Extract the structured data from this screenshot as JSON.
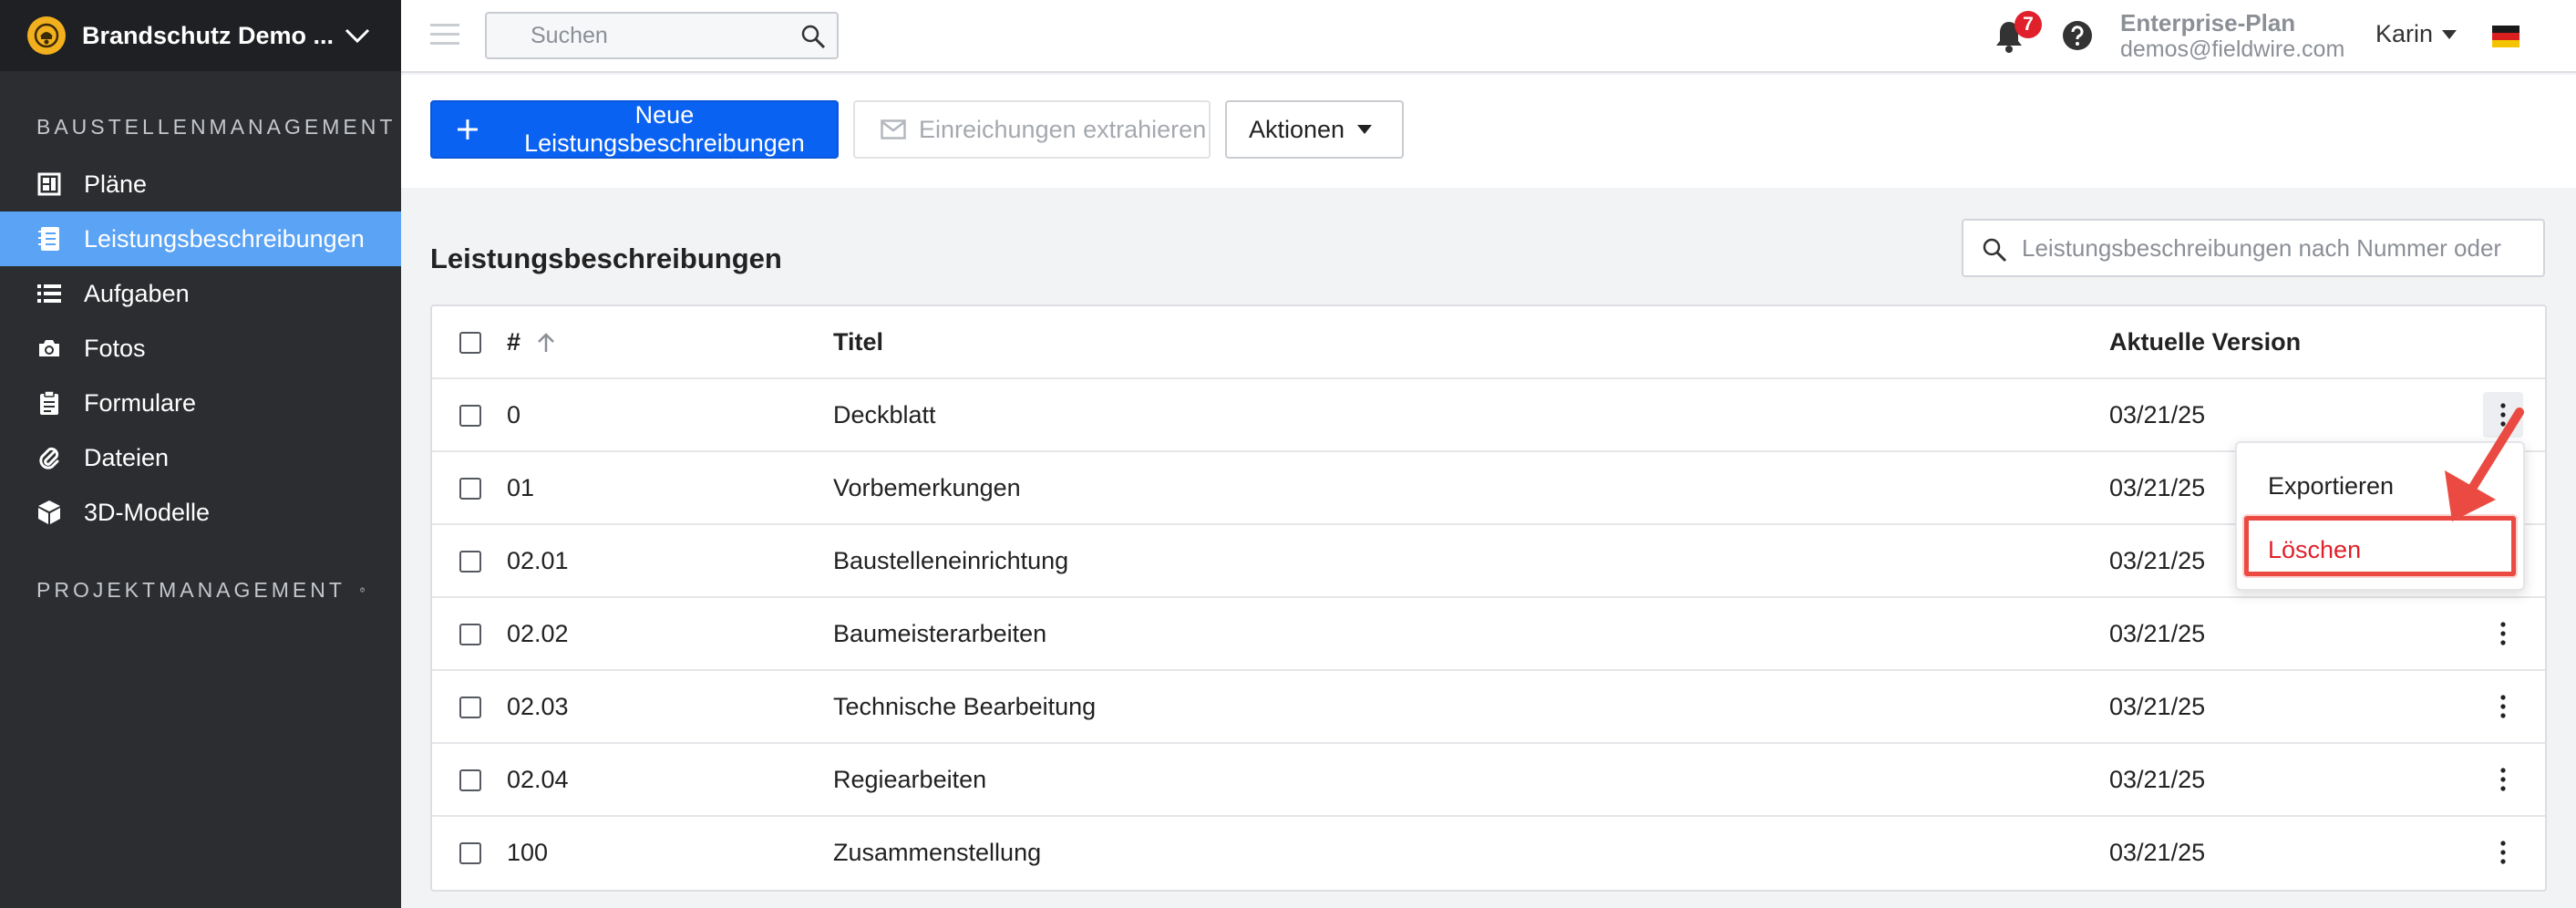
{
  "sidebar": {
    "project_name": "Brandschutz Demo ...",
    "section_site": "BAUSTELLENMANAGEMENT",
    "section_project": "PROJEKTMANAGEMENT",
    "items": [
      {
        "label": "Pläne",
        "icon": "plans-icon"
      },
      {
        "label": "Leistungsbeschreibungen",
        "icon": "specs-icon",
        "active": true
      },
      {
        "label": "Aufgaben",
        "icon": "list-icon"
      },
      {
        "label": "Fotos",
        "icon": "camera-icon"
      },
      {
        "label": "Formulare",
        "icon": "clipboard-icon"
      },
      {
        "label": "Dateien",
        "icon": "paperclip-icon"
      },
      {
        "label": "3D-Modelle",
        "icon": "cube-icon"
      }
    ]
  },
  "topbar": {
    "search_placeholder": "Suchen",
    "notification_count": "7",
    "plan_name": "Enterprise-Plan",
    "account_email": "demos@fieldwire.com",
    "user_name": "Karin"
  },
  "toolbar": {
    "new_button": "Neue Leistungsbeschreibungen",
    "extract_button": "Einreichungen extrahieren",
    "actions_button": "Aktionen"
  },
  "main": {
    "title": "Leistungsbeschreibungen",
    "filter_placeholder": "Leistungsbeschreibungen nach Nummer oder"
  },
  "table": {
    "columns": [
      "#",
      "Titel",
      "Aktuelle Version"
    ],
    "rows": [
      {
        "number": "0",
        "title": "Deckblatt",
        "version": "03/21/25"
      },
      {
        "number": "01",
        "title": "Vorbemerkungen",
        "version": "03/21/25"
      },
      {
        "number": "02.01",
        "title": "Baustelleneinrichtung",
        "version": "03/21/25"
      },
      {
        "number": "02.02",
        "title": "Baumeisterarbeiten",
        "version": "03/21/25"
      },
      {
        "number": "02.03",
        "title": "Technische Bearbeitung",
        "version": "03/21/25"
      },
      {
        "number": "02.04",
        "title": "Regiearbeiten",
        "version": "03/21/25"
      },
      {
        "number": "100",
        "title": "Zusammenstellung",
        "version": "03/21/25"
      }
    ]
  },
  "row_menu": {
    "export": "Exportieren",
    "delete": "Löschen"
  },
  "colors": {
    "sidebar_bg": "#2b2d30",
    "active_item": "#5aa3f5",
    "primary_button": "#0a62f2",
    "danger": "#e0202a",
    "annotation": "#ea4a41"
  }
}
